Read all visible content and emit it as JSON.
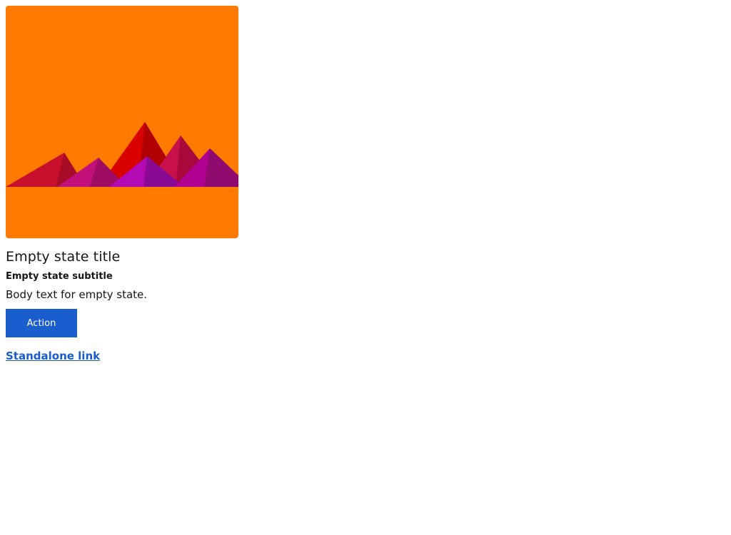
{
  "empty_state": {
    "illustration": {
      "icon": "mountains-illustration",
      "background_color": "#ff7a00",
      "colors": [
        "#c8102e",
        "#a70c26",
        "#d90000",
        "#b00000",
        "#c8104a",
        "#a8093a",
        "#c2107a",
        "#9e0d62",
        "#b40ab4",
        "#8a0a94",
        "#b00090",
        "#8e0a6e"
      ]
    },
    "title": "Empty state title",
    "subtitle": "Empty state subtitle",
    "body": "Body text for empty state.",
    "action_label": "Action",
    "link_label": "Standalone link"
  },
  "colors": {
    "button": "#1a5dcc",
    "link": "#1a5dcc"
  }
}
